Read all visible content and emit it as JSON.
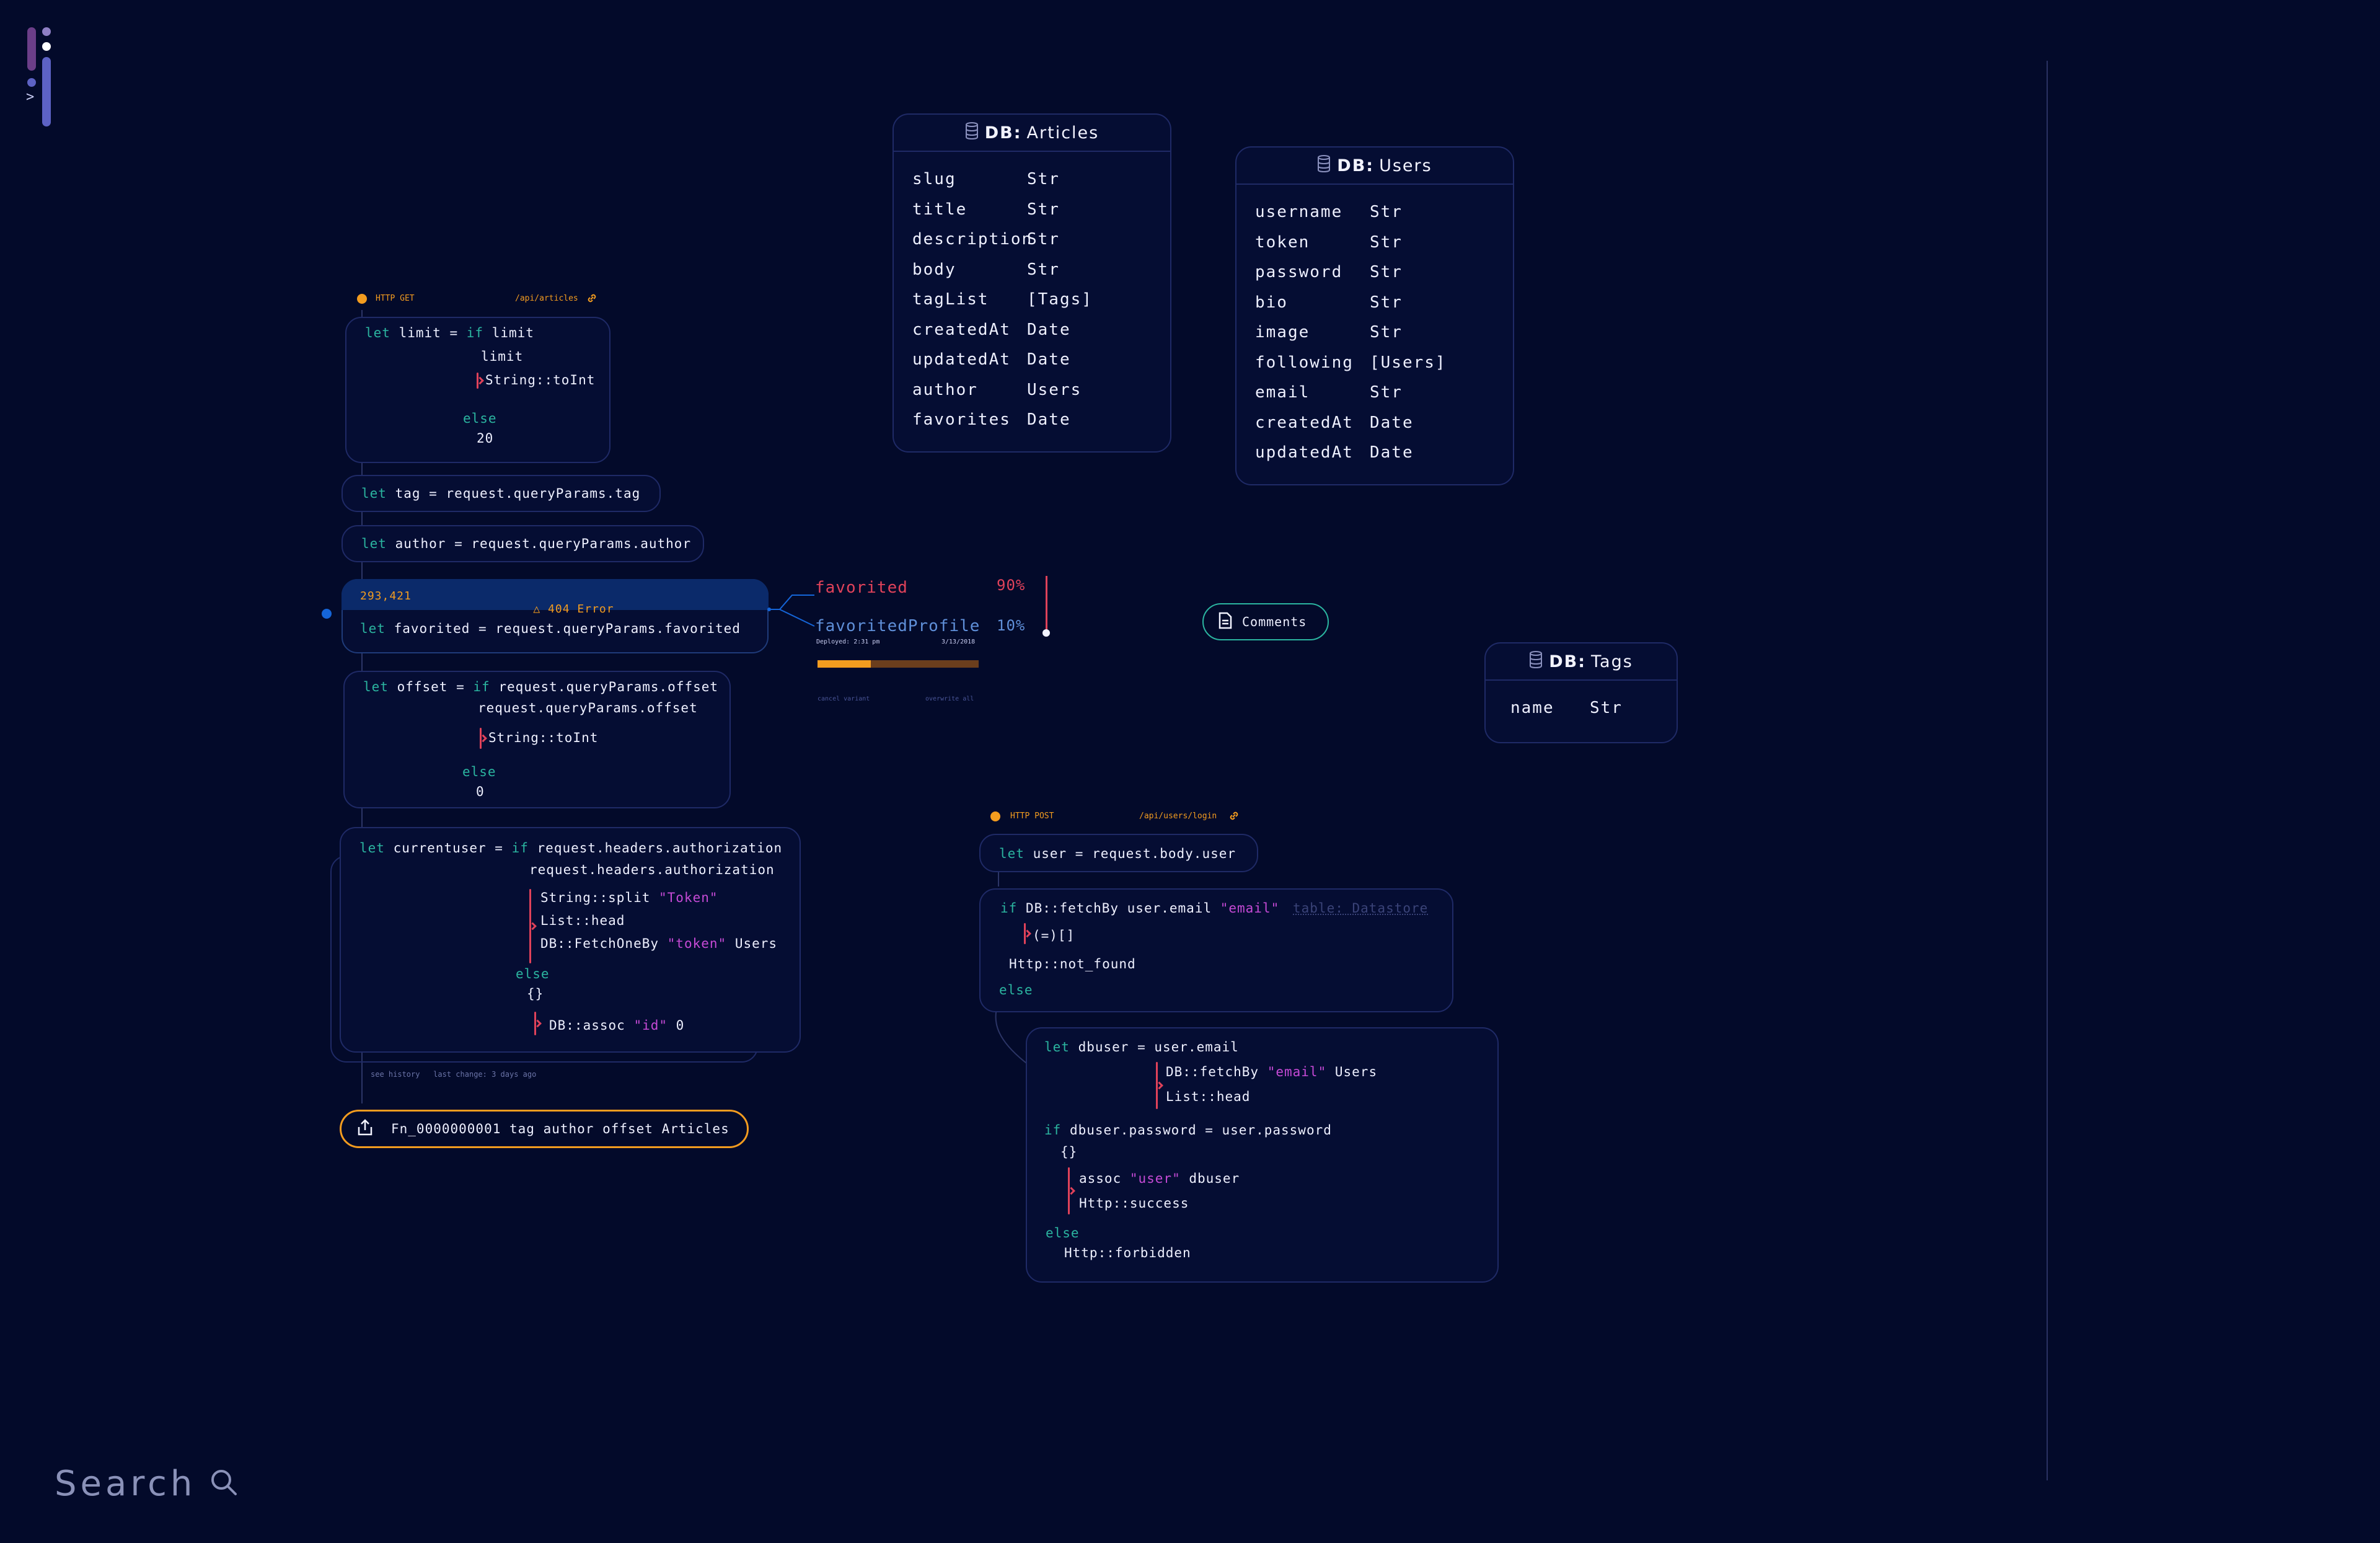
{
  "logo": {
    "caret": ">"
  },
  "search": {
    "label": "Search"
  },
  "databases": [
    {
      "prefix": "DB:",
      "name": "Articles",
      "fields": [
        {
          "name": "slug",
          "type": "Str"
        },
        {
          "name": "title",
          "type": "Str"
        },
        {
          "name": "description",
          "type": "Str"
        },
        {
          "name": "body",
          "type": "Str"
        },
        {
          "name": "tagList",
          "type": "[Tags]"
        },
        {
          "name": "createdAt",
          "type": "Date"
        },
        {
          "name": "updatedAt",
          "type": "Date"
        },
        {
          "name": "author",
          "type": "Users"
        },
        {
          "name": "favorites",
          "type": "Date"
        }
      ]
    },
    {
      "prefix": "DB:",
      "name": "Users",
      "fields": [
        {
          "name": "username",
          "type": "Str"
        },
        {
          "name": "token",
          "type": "Str"
        },
        {
          "name": "password",
          "type": "Str"
        },
        {
          "name": "bio",
          "type": "Str"
        },
        {
          "name": "image",
          "type": "Str"
        },
        {
          "name": "following",
          "type": "[Users]"
        },
        {
          "name": "email",
          "type": "Str"
        },
        {
          "name": "createdAt",
          "type": "Date"
        },
        {
          "name": "updatedAt",
          "type": "Date"
        }
      ]
    },
    {
      "prefix": "DB:",
      "name": "Tags",
      "fields": [
        {
          "name": "name",
          "type": "Str"
        }
      ]
    }
  ],
  "handler_get": {
    "method": "HTTP  GET",
    "route": "/api/articles",
    "limit": {
      "l1": "limit = ",
      "kw_if": "if",
      "l1b": " limit",
      "l2": "limit",
      "l3": "String::toInt",
      "else": "else",
      "l5": "20"
    },
    "tag": {
      "kw": "let",
      "text": " tag = request.queryParams.tag"
    },
    "author": {
      "kw": "let",
      "text": " author = request.queryParams.author"
    },
    "favorited": {
      "count": "293,421",
      "error": "404 Error",
      "kw": "let",
      "text": " favorited = request.queryParams.favorited"
    },
    "offset": {
      "l1": " offset = ",
      "kw_if": "if",
      "l1b": " request.queryParams.offset",
      "l2": "request.queryParams.offset",
      "l3": "String::toInt",
      "else": "else",
      "l5": "0"
    },
    "currentuser": {
      "l1": " currentuser = ",
      "kw_if": "if",
      "l1b": " request.headers.authorization",
      "l2": "request.headers.authorization",
      "p1": "String::split ",
      "p1s": "\"Token\"",
      "p2": "List::head",
      "p3": "DB::FetchOneBy ",
      "p3s": "\"token\"",
      "p3b": " Users",
      "else": "else",
      "l6": "{}",
      "p4": "DB::assoc ",
      "p4s": "\"id\"",
      "p4b": " 0"
    },
    "history": {
      "see": "see history",
      "last": "last change: 3 days ago"
    },
    "fn_return": "Fn_0000000001 tag author offset Articles"
  },
  "feature_flag": {
    "a_label": "favorited",
    "a_pct": "90%",
    "b_label": "favoritedProfile",
    "b_pct": "10%",
    "deployed": "Deployed: 2:31 pm",
    "date": "3/13/2018",
    "progress": 0.33,
    "cancel": "cancel variant",
    "overwrite": "overwrite all"
  },
  "comments_button": "Comments",
  "handler_post": {
    "method": "HTTP  POST",
    "route": "/api/users/login",
    "user": {
      "kw": "let",
      "text": " user = request.body.user"
    },
    "fetch": {
      "kw_if": "if",
      "l1": " DB::fetchBy user.email ",
      "l1s": "\"email\"",
      "hint": "table: Datastore",
      "l2": "(=)[]",
      "l3": "Http::not_found",
      "else": "else"
    },
    "dbuser": {
      "kw": "let",
      "l1": " dbuser = user.email",
      "p1": "DB::fetchBy ",
      "p1s": "\"email\"",
      "p1b": " Users",
      "p2": "List::head",
      "kw_if": "if",
      "l3": " dbuser.password = user.password",
      "l4": "{}",
      "p3": "assoc ",
      "p3s": "\"user\"",
      "p3b": " dbuser",
      "p4": "Http::success",
      "else": "else",
      "l7": "Http::forbidden"
    }
  },
  "colors": {
    "bg": "#030a2a",
    "accent_orange": "#f39c1f",
    "accent_teal": "#2bb5a0",
    "accent_red": "#e0425a",
    "accent_blue": "#1565d8"
  }
}
